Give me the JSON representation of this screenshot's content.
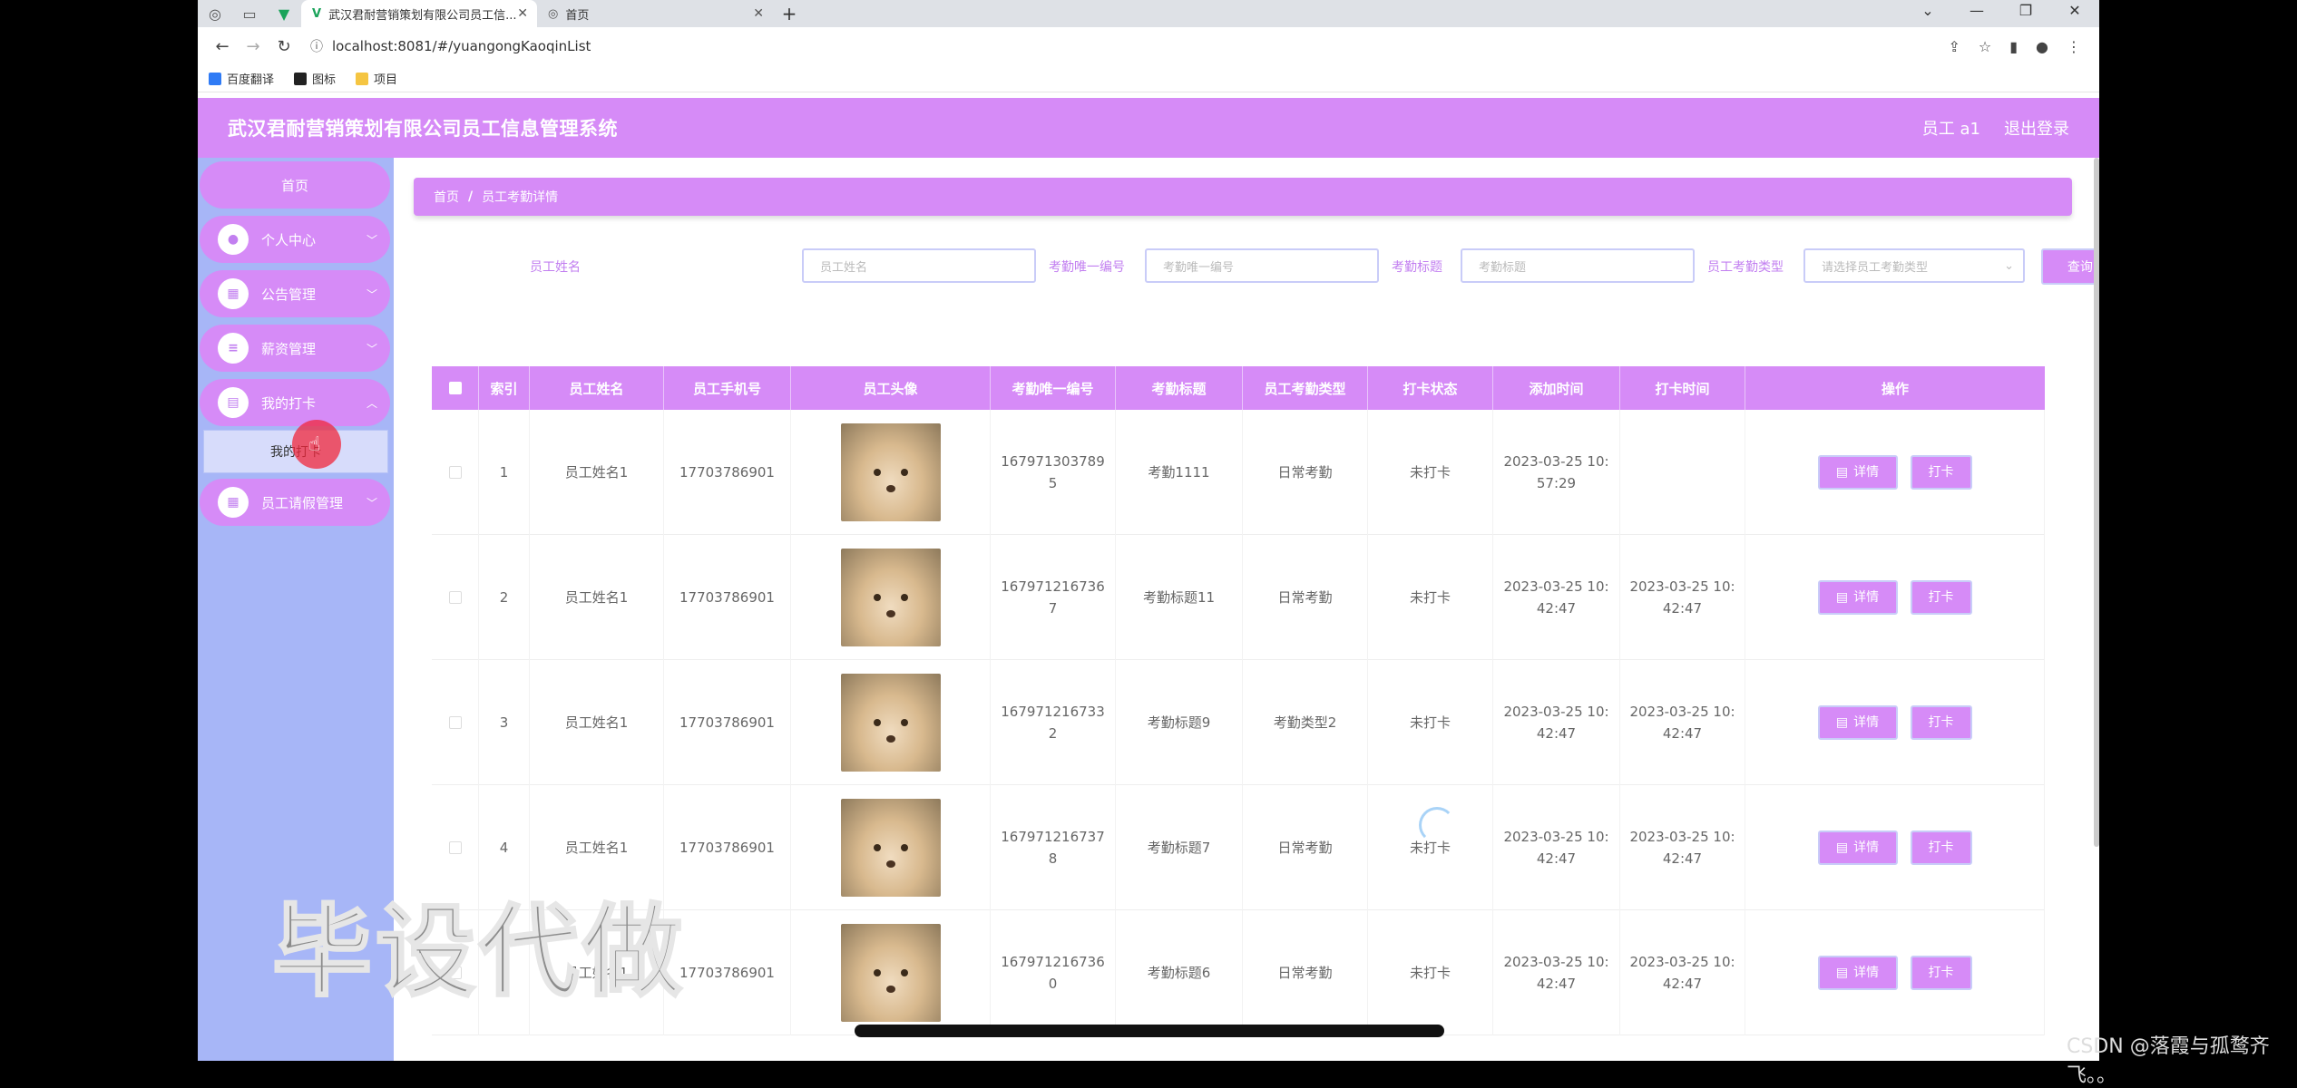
{
  "browser": {
    "tabs": [
      {
        "label": "武汉君耐营销策划有限公司员工信...",
        "active": true
      },
      {
        "label": "首页",
        "active": false
      }
    ],
    "url": "localhost:8081/#/yuangongKaoqinList",
    "bookmarks": [
      "百度翻译",
      "图标",
      "项目"
    ]
  },
  "header": {
    "title": "武汉君耐营销策划有限公司员工信息管理系统",
    "user": "员工 a1",
    "logout": "退出登录"
  },
  "sidebar": {
    "home": "首页",
    "items": [
      {
        "label": "个人中心",
        "icon": "user-icon"
      },
      {
        "label": "公告管理",
        "icon": "grid-icon"
      },
      {
        "label": "薪资管理",
        "icon": "list-icon"
      },
      {
        "label": "我的打卡",
        "icon": "card-icon"
      }
    ],
    "sub_item": "我的打卡",
    "last_item": {
      "label": "员工请假管理",
      "icon": "apps-icon"
    }
  },
  "breadcrumb": {
    "home": "首页",
    "sep": "/",
    "current": "员工考勤详情"
  },
  "filters": {
    "name_label": "员工姓名",
    "name_placeholder": "员工姓名",
    "code_label": "考勤唯一编号",
    "code_placeholder": "考勤唯一编号",
    "title_label": "考勤标题",
    "title_placeholder": "考勤标题",
    "type_label": "员工考勤类型",
    "type_placeholder": "请选择员工考勤类型",
    "search_label": "查询"
  },
  "table": {
    "headers": [
      "索引",
      "员工姓名",
      "员工手机号",
      "员工头像",
      "考勤唯一编号",
      "考勤标题",
      "员工考勤类型",
      "打卡状态",
      "添加时间",
      "打卡时间",
      "操作"
    ],
    "detail_label": "详情",
    "punch_label": "打卡",
    "rows": [
      {
        "idx": "1",
        "name": "员工姓名1",
        "phone": "17703786901",
        "code1": "167971303789",
        "code2": "5",
        "title": "考勤1111",
        "type": "日常考勤",
        "status": "未打卡",
        "add1": "2023-03-25 10:",
        "add2": "57:29",
        "punch1": "",
        "punch2": ""
      },
      {
        "idx": "2",
        "name": "员工姓名1",
        "phone": "17703786901",
        "code1": "167971216736",
        "code2": "7",
        "title": "考勤标题11",
        "type": "日常考勤",
        "status": "未打卡",
        "add1": "2023-03-25 10:",
        "add2": "42:47",
        "punch1": "2023-03-25 10:",
        "punch2": "42:47"
      },
      {
        "idx": "3",
        "name": "员工姓名1",
        "phone": "17703786901",
        "code1": "167971216733",
        "code2": "2",
        "title": "考勤标题9",
        "type": "考勤类型2",
        "status": "未打卡",
        "add1": "2023-03-25 10:",
        "add2": "42:47",
        "punch1": "2023-03-25 10:",
        "punch2": "42:47"
      },
      {
        "idx": "4",
        "name": "员工姓名1",
        "phone": "17703786901",
        "code1": "167971216737",
        "code2": "8",
        "title": "考勤标题7",
        "type": "日常考勤",
        "status": "未打卡",
        "add1": "2023-03-25 10:",
        "add2": "42:47",
        "punch1": "2023-03-25 10:",
        "punch2": "42:47"
      },
      {
        "idx": "5",
        "name": "员工姓名1",
        "phone": "17703786901",
        "code1": "167971216736",
        "code2": "0",
        "title": "考勤标题6",
        "type": "日常考勤",
        "status": "未打卡",
        "add1": "2023-03-25 10:",
        "add2": "42:47",
        "punch1": "2023-03-25 10:",
        "punch2": "42:47"
      }
    ]
  },
  "overlay": {
    "watermark": "毕设代做",
    "credit": "CSDN @落霞与孤鹜齐飞。。"
  },
  "colors": {
    "accent": "#d68bf7",
    "sidebar": "#a7b6f7"
  }
}
